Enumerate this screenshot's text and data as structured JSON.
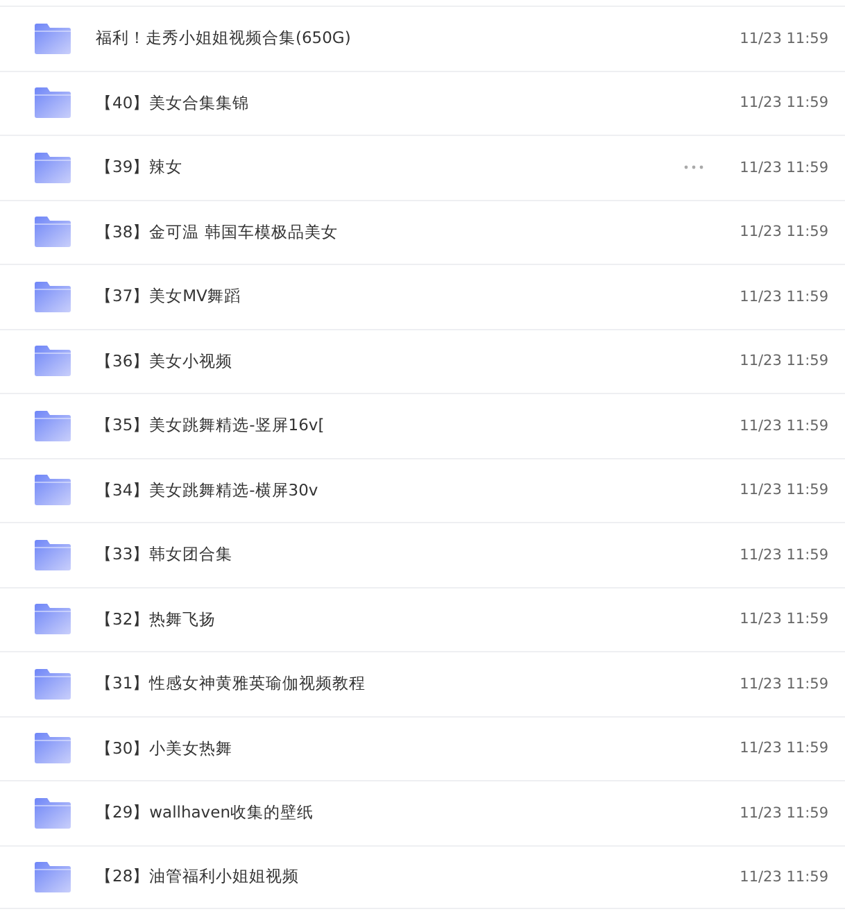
{
  "files": [
    {
      "name": "福利！走秀小姐姐视频合集(650G)",
      "modified": "11/23 11:59",
      "hovered": false
    },
    {
      "name": "【40】美女合集集锦",
      "modified": "11/23 11:59",
      "hovered": false
    },
    {
      "name": "【39】辣女",
      "modified": "11/23 11:59",
      "hovered": true
    },
    {
      "name": "【38】金可温 韩国车模极品美女",
      "modified": "11/23 11:59",
      "hovered": false
    },
    {
      "name": "【37】美女MV舞蹈",
      "modified": "11/23 11:59",
      "hovered": false
    },
    {
      "name": "【36】美女小视频",
      "modified": "11/23 11:59",
      "hovered": false
    },
    {
      "name": "【35】美女跳舞精选-竖屏16v[",
      "modified": "11/23 11:59",
      "hovered": false
    },
    {
      "name": "【34】美女跳舞精选-横屏30v",
      "modified": "11/23 11:59",
      "hovered": false
    },
    {
      "name": "【33】韩女团合集",
      "modified": "11/23 11:59",
      "hovered": false
    },
    {
      "name": "【32】热舞飞扬",
      "modified": "11/23 11:59",
      "hovered": false
    },
    {
      "name": "【31】性感女神黄雅英瑜伽视频教程",
      "modified": "11/23 11:59",
      "hovered": false
    },
    {
      "name": "【30】小美女热舞",
      "modified": "11/23 11:59",
      "hovered": false
    },
    {
      "name": "【29】wallhaven收集的壁纸",
      "modified": "11/23 11:59",
      "hovered": false
    },
    {
      "name": "【28】油管福利小姐姐视频",
      "modified": "11/23 11:59",
      "hovered": false
    }
  ]
}
